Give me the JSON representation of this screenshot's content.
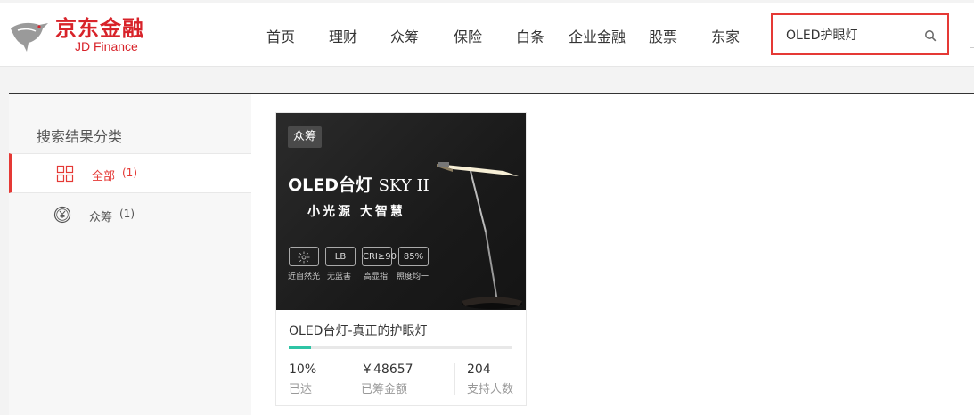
{
  "brand": {
    "name_cn": "京东金融",
    "name_en": "JD Finance",
    "color": "#d8232a"
  },
  "nav": [
    {
      "label": "首页",
      "id": "home"
    },
    {
      "label": "理财",
      "id": "wealth"
    },
    {
      "label": "众筹",
      "id": "crowdfunding"
    },
    {
      "label": "保险",
      "id": "insurance"
    },
    {
      "label": "白条",
      "id": "baitiao"
    },
    {
      "label": "企业金融",
      "id": "enterprise"
    },
    {
      "label": "股票",
      "id": "stocks"
    },
    {
      "label": "东家",
      "id": "dongjia"
    }
  ],
  "search": {
    "value": "OLED护眼灯",
    "icon": "search-icon",
    "highlight_color": "#e53935"
  },
  "sidebar": {
    "title": "搜索结果分类",
    "items": [
      {
        "label": "全部",
        "count": "(1)",
        "icon": "grid-icon",
        "active": true
      },
      {
        "label": "众筹",
        "count": "(1)",
        "icon": "yuan-coin-icon",
        "active": false
      }
    ]
  },
  "results": [
    {
      "badge": "众筹",
      "image": {
        "title": "OLED台灯",
        "model": "SKY II",
        "slogan": "小光源 大智慧",
        "features": [
          {
            "icon": "sunlight-icon",
            "text": "",
            "label": "近自然光"
          },
          {
            "icon": "",
            "text": "LB",
            "label": "无蓝害"
          },
          {
            "icon": "",
            "text": "CRI≥90",
            "label": "高显指"
          },
          {
            "icon": "",
            "text": "85%",
            "label": "照度均一"
          }
        ]
      },
      "name": "OLED台灯-真正的护眼灯",
      "progress_percent": 10,
      "progress_color": "#2ec4a5",
      "stats": [
        {
          "value": "10%",
          "label": "已达"
        },
        {
          "value": "￥48657",
          "label": "已筹金额"
        },
        {
          "value": "204",
          "label": "支持人数"
        }
      ]
    }
  ]
}
